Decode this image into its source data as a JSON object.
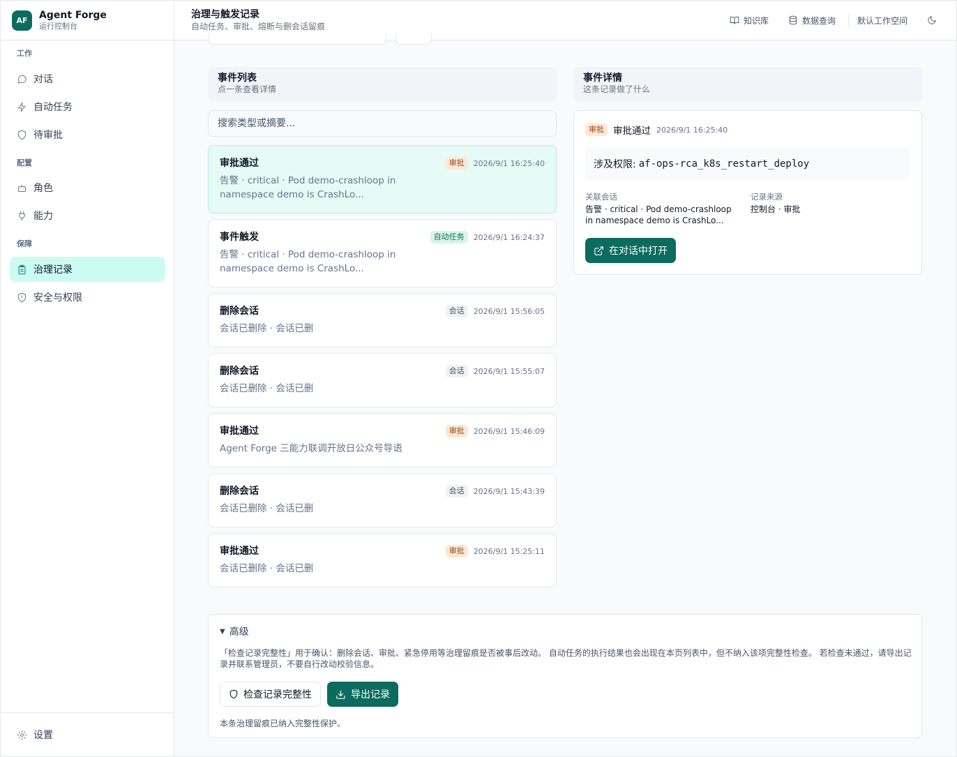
{
  "brand": {
    "logo": "AF",
    "name": "Agent Forge",
    "subtitle": "运行控制台"
  },
  "sidebar": {
    "sections": [
      {
        "label": "工作"
      },
      {
        "label": "配置"
      },
      {
        "label": "保障"
      }
    ],
    "items": [
      {
        "label": "对话",
        "icon": "message-circle-icon"
      },
      {
        "label": "自动任务",
        "icon": "zap-icon"
      },
      {
        "label": "待审批",
        "icon": "shield-icon"
      },
      {
        "label": "角色",
        "icon": "bot-icon"
      },
      {
        "label": "能力",
        "icon": "plug-icon"
      },
      {
        "label": "治理记录",
        "icon": "clipboard-icon",
        "active": true
      },
      {
        "label": "安全与权限",
        "icon": "shield-alert-icon"
      }
    ],
    "settings_label": "设置"
  },
  "header": {
    "title": "治理与触发记录",
    "subtitle": "自动任务、审批、熔断与删会话留痕",
    "actions": {
      "knowledge": "知识库",
      "data_query": "数据查询",
      "workspace": "默认工作空间"
    }
  },
  "events_panel": {
    "title": "事件列表",
    "subtitle": "点一条查看详情",
    "search_placeholder": "搜索类型或摘要...",
    "events": [
      {
        "title": "审批通过",
        "badge": "审批",
        "time": "2026/9/1 16:25:40",
        "summary": "告警 · critical · Pod demo-crashloop in namespace demo is CrashLo..."
      },
      {
        "title": "事件触发",
        "badge": "自动任务",
        "time": "2026/9/1 16:24:37",
        "summary": "告警 · critical · Pod demo-crashloop in namespace demo is CrashLo..."
      },
      {
        "title": "删除会话",
        "badge": "会话",
        "time": "2026/9/1 15:56:05",
        "summary": "会话已删除 · 会话已删"
      },
      {
        "title": "删除会话",
        "badge": "会话",
        "time": "2026/9/1 15:55:07",
        "summary": "会话已删除 · 会话已删"
      },
      {
        "title": "审批通过",
        "badge": "审批",
        "time": "2026/9/1 15:46:09",
        "summary": "Agent Forge 三能力联调开放日公众号导语"
      },
      {
        "title": "删除会话",
        "badge": "会话",
        "time": "2026/9/1 15:43:39",
        "summary": "会话已删除 · 会话已删"
      },
      {
        "title": "审批通过",
        "badge": "审批",
        "time": "2026/9/1 15:25:11",
        "summary": "会话已删除 · 会话已删"
      }
    ]
  },
  "detail_panel": {
    "title": "事件详情",
    "subtitle": "这条记录做了什么",
    "badge": "审批",
    "event_title": "审批通过",
    "time": "2026/9/1 16:25:40",
    "permission_label": "涉及权限:",
    "permission_value": "af-ops-rca_k8s_restart_deploy",
    "session_label": "关联会话",
    "session_value": "告警 · critical · Pod demo-crashloop in namespace demo is CrashLo...",
    "source_label": "记录来源",
    "source_value": "控制台 · 审批",
    "open_button": "在对话中打开"
  },
  "advanced": {
    "toggle_label": "高级",
    "description": "「检查记录完整性」用于确认：删除会话、审批、紧急停用等治理留痕是否被事后改动。 自动任务的执行结果也会出现在本页列表中，但不纳入该项完整性检查。 若检查未通过，请导出记录并联系管理员，不要自行改动校验信息。",
    "check_button": "检查记录完整性",
    "export_button": "导出记录",
    "note": "本条治理留痕已纳入完整性保护。"
  },
  "colors": {
    "accent": "#0b6b5e",
    "active_nav": "#ccfbf1",
    "selected_event": "#e6faf6"
  }
}
